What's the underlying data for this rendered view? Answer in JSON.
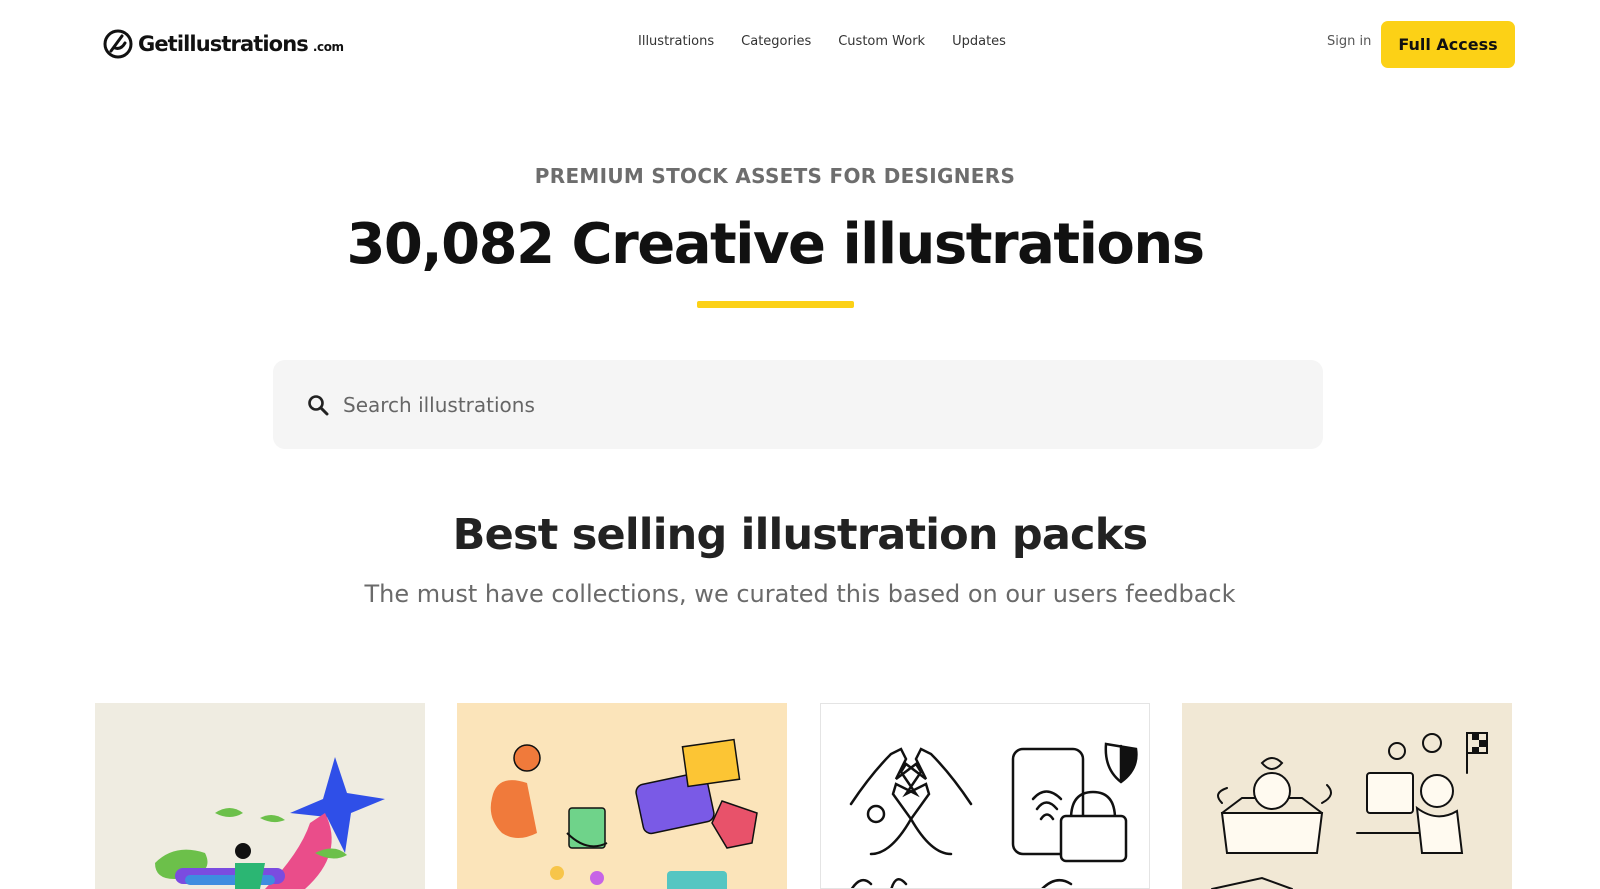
{
  "header": {
    "logo": {
      "brand": "Getillustrations",
      "suffix": ".com",
      "icon": "logo-mark-icon"
    },
    "nav": [
      {
        "label": "Illustrations"
      },
      {
        "label": "Categories"
      },
      {
        "label": "Custom Work"
      },
      {
        "label": "Updates"
      }
    ],
    "sign_in": "Sign in",
    "cta": "Full Access"
  },
  "hero": {
    "eyebrow": "PREMIUM STOCK ASSETS FOR DESIGNERS",
    "title": "30,082 Creative illustrations",
    "accent_color": "#fcd116"
  },
  "search": {
    "icon": "search-icon",
    "placeholder": "Search illustrations",
    "value": ""
  },
  "section": {
    "title": "Best selling illustration packs",
    "subtitle": "The must have collections, we curated this based on our users feedback"
  },
  "packs": [
    {
      "background": "#efece1",
      "theme": "colorful-flat-character"
    },
    {
      "background": "#fbe4ba",
      "theme": "colorful-doodle-gifts"
    },
    {
      "background": "#ffffff",
      "theme": "line-art-hands-security"
    },
    {
      "background": "#f1e8d5",
      "theme": "sketch-characters"
    }
  ]
}
